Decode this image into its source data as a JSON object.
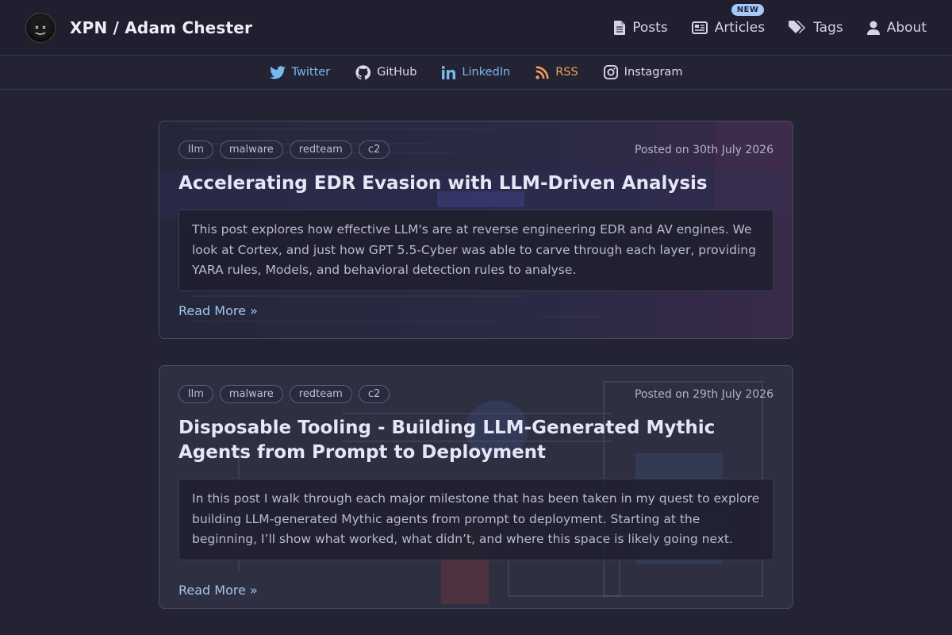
{
  "site": {
    "title": "XPN / Adam Chester"
  },
  "nav": [
    {
      "label": "Posts",
      "icon": "file-icon"
    },
    {
      "label": "Articles",
      "icon": "newspaper-icon",
      "badge": "NEW"
    },
    {
      "label": "Tags",
      "icon": "tags-icon"
    },
    {
      "label": "About",
      "icon": "user-icon"
    }
  ],
  "social": [
    {
      "label": "Twitter",
      "icon": "twitter-icon",
      "color": "#79b8ef"
    },
    {
      "label": "GitHub",
      "icon": "github-icon",
      "color": "#dcdce8"
    },
    {
      "label": "LinkedIn",
      "icon": "linkedin-icon",
      "color": "#79b8ef"
    },
    {
      "label": "RSS",
      "icon": "rss-icon",
      "color": "#f0a15a"
    },
    {
      "label": "Instagram",
      "icon": "instagram-icon",
      "color": "#dcdce8"
    }
  ],
  "posts": [
    {
      "tags": [
        "llm",
        "malware",
        "redteam",
        "c2"
      ],
      "date": "Posted on 30th July 2026",
      "title": "Accelerating EDR Evasion with LLM-Driven Analysis",
      "summary": "This post explores how effective LLM's are at reverse engineering EDR and AV engines. We look at Cortex, and just how GPT 5.5-Cyber was able to carve through each layer, providing YARA rules, Models, and behavioral detection rules to analyse.",
      "read_more": "Read More »"
    },
    {
      "tags": [
        "llm",
        "malware",
        "redteam",
        "c2"
      ],
      "date": "Posted on 29th July 2026",
      "title": "Disposable Tooling - Building LLM-Generated Mythic Agents from Prompt to Deployment",
      "summary": "In this post I walk through each major milestone that has been taken in my quest to explore building LLM-generated Mythic agents from prompt to deployment. Starting at the beginning, I’ll show what worked, what didn’t, and where this space is likely going next.",
      "read_more": "Read More »"
    }
  ],
  "colors": {
    "accent": "#9fc5f0",
    "background": "#232334",
    "header": "#1f1f30"
  }
}
